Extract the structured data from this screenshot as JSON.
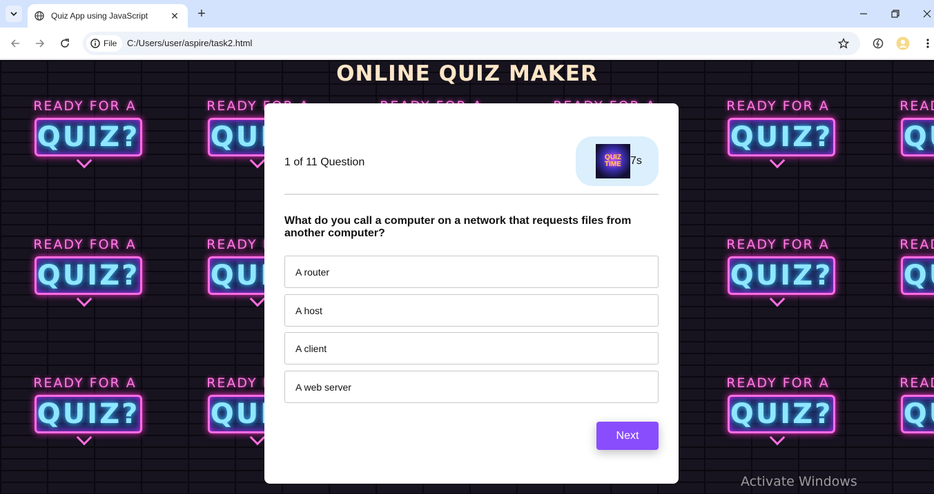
{
  "browser": {
    "tab_title": "Quiz App using JavaScript",
    "file_chip": "File",
    "url": "C:/Users/user/aspire/task2.html"
  },
  "page": {
    "heading": "ONLINE QUIZ MAKER",
    "background_tile": {
      "top": "READY FOR A",
      "main": "QUIZ?"
    }
  },
  "quiz": {
    "counter": "1 of 11 Question",
    "timer": "7s",
    "timer_image_text": "QUIZ TIME",
    "question": "What do you call a computer on a network that requests files from another computer?",
    "options": [
      "A router",
      "A host",
      "A client",
      "A web server"
    ],
    "next_label": "Next"
  },
  "watermark": "Activate Windows",
  "colors": {
    "accent": "#8a4dfd",
    "timer_bg": "#dbeffc",
    "heading": "#fde6c7",
    "tabbar": "#d3e3fd"
  }
}
